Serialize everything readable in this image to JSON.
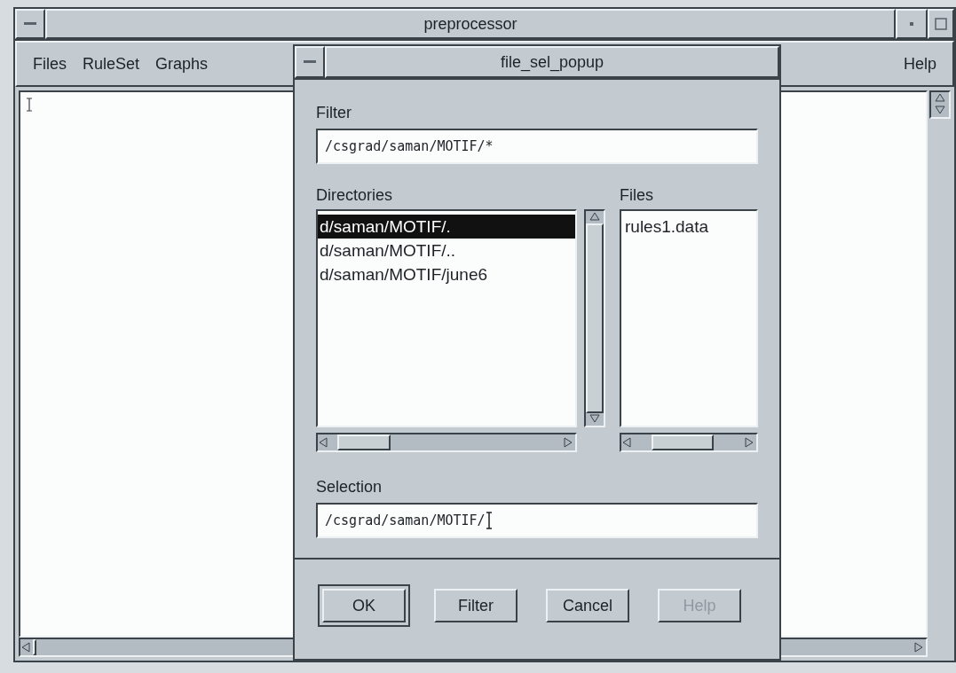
{
  "main_window": {
    "title": "preprocessor",
    "menus": [
      {
        "label": "Files"
      },
      {
        "label": "RuleSet"
      },
      {
        "label": "Graphs"
      }
    ],
    "help_menu": "Help"
  },
  "dialog": {
    "title": "file_sel_popup",
    "filter_label": "Filter",
    "filter_value": "/csgrad/saman/MOTIF/*",
    "directories_label": "Directories",
    "directories": [
      {
        "label": "d/saman/MOTIF/.",
        "selected": true
      },
      {
        "label": "d/saman/MOTIF/..",
        "selected": false
      },
      {
        "label": "d/saman/MOTIF/june6",
        "selected": false
      }
    ],
    "files_label": "Files",
    "files": [
      {
        "label": "rules1.data",
        "selected": false
      }
    ],
    "selection_label": "Selection",
    "selection_value": "/csgrad/saman/MOTIF/",
    "buttons": [
      {
        "label": "OK",
        "default": true,
        "disabled": false
      },
      {
        "label": "Filter",
        "default": false,
        "disabled": false
      },
      {
        "label": "Cancel",
        "default": false,
        "disabled": false
      },
      {
        "label": "Help",
        "default": false,
        "disabled": true
      }
    ]
  }
}
